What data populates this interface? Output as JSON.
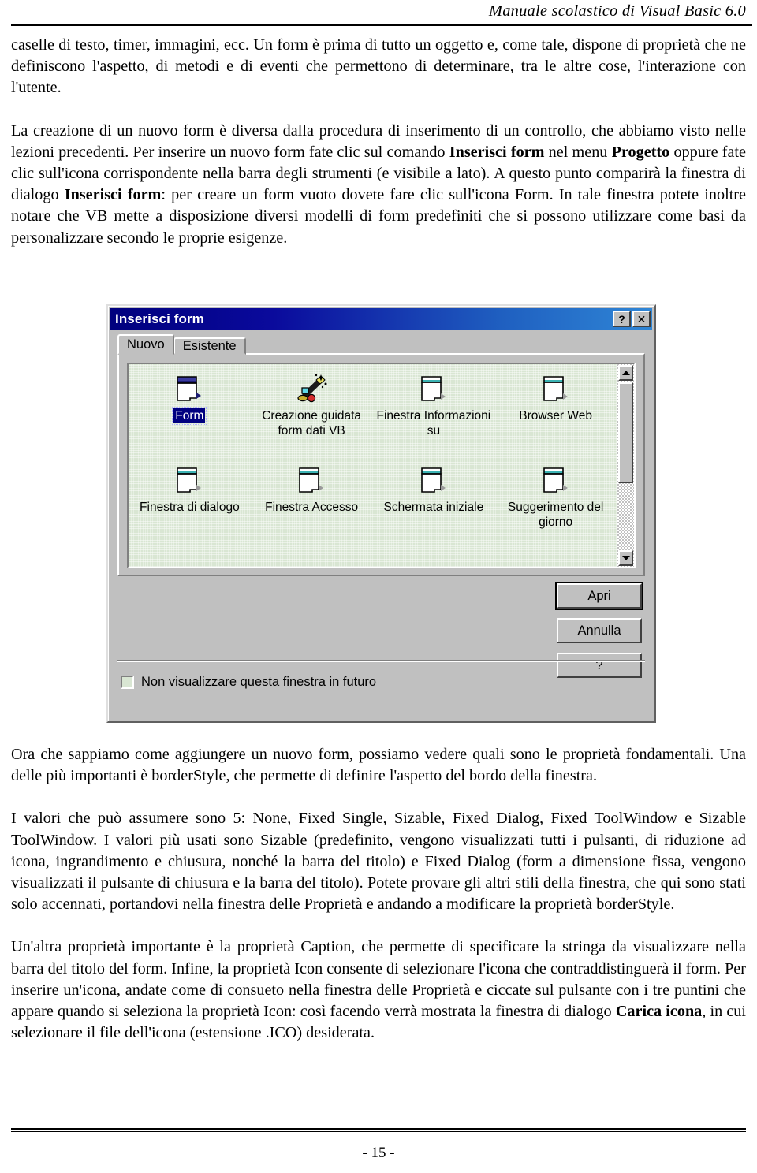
{
  "header": {
    "title": "Manuale scolastico di Visual Basic 6.0"
  },
  "body": {
    "p1_a": "caselle di testo, timer, immagini, ecc. ",
    "p1_b": "Un form è prima di tutto un oggetto e, come tale, dispone di proprietà che ne definiscono l'aspetto, di metodi e di eventi che permettono di determinare, tra le altre cose, l'interazione con l'utente.",
    "p2_s1": "La creazione di un nuovo form è diversa dalla procedura di inserimento di un controllo, che abbiamo visto nelle lezioni precedenti. Per inserire un nuovo form fate clic sul comando ",
    "p2_b1": "Inserisci form",
    "p2_s2": " nel menu ",
    "p2_b2": "Progetto",
    "p2_s3": " oppure fate clic sull'icona corrispondente nella barra degli strumenti (e visibile a lato). A questo punto comparirà la finestra di dialogo ",
    "p2_b3": "Inserisci form",
    "p2_s4": ": per creare un form vuoto dovete fare clic sull'icona Form. In tale finestra potete inoltre notare che VB mette a disposizione diversi modelli di form predefiniti che si possono utilizzare come basi da personalizzare secondo le proprie esigenze.",
    "p3": "Ora che sappiamo come aggiungere un nuovo form, possiamo vedere quali sono le proprietà fondamentali. Una delle più importanti è borderStyle, che permette di definire l'aspetto del bordo della finestra.",
    "p4": "I valori che può assumere sono 5: None, Fixed Single, Sizable, Fixed Dialog, Fixed ToolWindow e Sizable ToolWindow. I valori più usati sono Sizable (predefinito, vengono visualizzati tutti i pulsanti, di riduzione ad icona, ingrandimento e chiusura, nonché la barra del titolo) e Fixed Dialog (form a dimensione fissa, vengono visualizzati il pulsante di chiusura e la barra del titolo). Potete provare gli altri stili della finestra, che qui sono stati solo accennati, portandovi nella finestra delle Proprietà e andando a modificare la proprietà borderStyle.",
    "p5_s1": "Un'altra proprietà importante è la proprietà Caption, che permette di specificare la stringa da visualizzare nella barra del titolo del form. Infine, la proprietà Icon consente di selezionare l'icona che contraddistinguerà il form. Per inserire un'icona, andate come di consueto nella finestra delle Proprietà e ciccate sul pulsante con i tre puntini che appare quando si seleziona la proprietà Icon: così facendo verrà mostrata la finestra di dialogo ",
    "p5_b1": "Carica icona",
    "p5_s2": ", in cui selezionare il file dell'icona (estensione .ICO) desiderata."
  },
  "dialog": {
    "title": "Inserisci form",
    "help_button": "?",
    "close_button": "✕",
    "tabs": [
      {
        "label": "Nuovo",
        "active": true
      },
      {
        "label": "Esistente",
        "active": false
      }
    ],
    "icons": [
      {
        "label": "Form",
        "selected": true,
        "glyph": "form-icon"
      },
      {
        "label": "Creazione guidata form dati VB",
        "selected": false,
        "glyph": "wizard-wand-icon"
      },
      {
        "label": "Finestra Informazioni su",
        "selected": false,
        "glyph": "form-icon"
      },
      {
        "label": "Browser Web",
        "selected": false,
        "glyph": "form-icon"
      },
      {
        "label": "Finestra di dialogo",
        "selected": false,
        "glyph": "form-icon"
      },
      {
        "label": "Finestra Accesso",
        "selected": false,
        "glyph": "form-icon"
      },
      {
        "label": "Schermata iniziale",
        "selected": false,
        "glyph": "form-icon"
      },
      {
        "label": "Suggerimento del giorno",
        "selected": false,
        "glyph": "form-icon"
      }
    ],
    "buttons": {
      "open_accel": "A",
      "open_rest": "pri",
      "cancel": "Annulla",
      "help": "?"
    },
    "checkbox": {
      "label": "Non visualizzare questa finestra in futuro",
      "checked": false
    },
    "colors": {
      "titlebar_start": "#00007e",
      "titlebar_end": "#2f86d6",
      "face": "#c0c0c0",
      "listbox_bg": "#d9e6d3",
      "selection": "#000080"
    }
  },
  "footer": {
    "page_number": "- 15 -"
  }
}
